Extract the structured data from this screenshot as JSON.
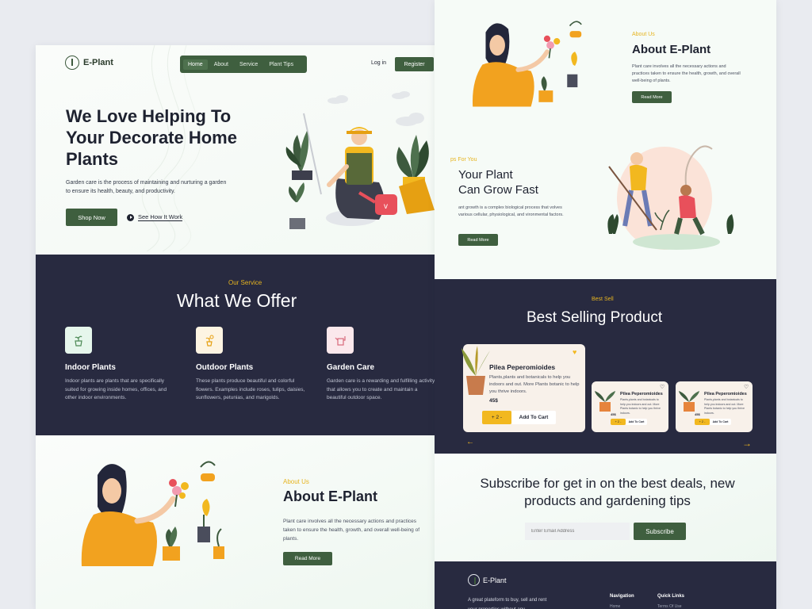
{
  "brand": {
    "name": "E-Plant"
  },
  "nav": {
    "items": [
      "Home",
      "About",
      "Service",
      "Plant Tips"
    ],
    "active": "Home",
    "login": "Log in",
    "register": "Register"
  },
  "hero": {
    "title": "We Love Helping To Your Decorate Home Plants",
    "description": "Garden care is the process of maintaining and nurturing a garden to ensure its health, beauty, and productivity.",
    "shop_button": "Shop Now",
    "video_link": "See How It Work"
  },
  "services": {
    "tag": "Our Service",
    "title": "What We Offer",
    "items": [
      {
        "name": "Indoor Plants",
        "description": "Indoor plants are plants that are specifically suited for growing inside homes, offices, and other indoor environments.",
        "icon": "potted-plant-icon",
        "icon_bg": "#e6f6ec"
      },
      {
        "name": "Outdoor Plants",
        "description": "These plants produce beautiful and colorful flowers. Examples include roses, tulips, daisies, sunflowers, petunias, and marigolds.",
        "icon": "sun-plant-icon",
        "icon_bg": "#fdf4e2"
      },
      {
        "name": "Garden Care",
        "description": "Garden care is a rewarding and fulfilling activity that allows you to create and maintain a beautiful outdoor space.",
        "icon": "watering-can-icon",
        "icon_bg": "#fbe8ec"
      }
    ]
  },
  "about": {
    "tag": "About Us",
    "title": "About E-Plant",
    "description": "Plant care involves all the necessary actions and practices taken to ensure the health, growth, and overall well-being of plants.",
    "button": "Read More"
  },
  "tips": {
    "tag": "ps For You",
    "title_line1": "Your Plant",
    "title_line2": "Can Grow Fast",
    "description": "ant growth is a complex biological process that volves various cellular, physiological, and vironmental factors.",
    "button": "Read More"
  },
  "best_sell": {
    "tag": "Best Sell",
    "title": "Best Selling Product",
    "products": [
      {
        "name": "Pilea Peperomioides",
        "description": "Plants,plants and botanicals to help you indoors and out. More Plants botanic to help you thrive indoors.",
        "price": "45$",
        "qty": "+ 2 -",
        "cart": "Add To Cart"
      },
      {
        "name": "Pilea Peperomioides",
        "description": "Plants,plants and botanicals to help you indoors and out. More Plants botanic to help you thrive indoors.",
        "price": "45$",
        "qty": "+ 2 -",
        "cart": "Add To Cart"
      },
      {
        "name": "Pilea Peperomioides",
        "description": "Plants,plants and botanicals to help you indoors and out. More Plants botanic to help you thrive indoors.",
        "price": "45$",
        "qty": "+ 2 -",
        "cart": "Add To Cart"
      }
    ]
  },
  "subscribe": {
    "title": "Subscribe for get in on the best deals, new products and gardening tips",
    "placeholder": "Enter Email Address",
    "button": "Subscribe"
  },
  "footer": {
    "brand": "E-Plant",
    "tagline": "A great plateform to buy, sell and rent your properties without any",
    "col1": "Navigation",
    "col1_item": "Home",
    "col2": "Quick Links",
    "col2_item": "Terms Of Use"
  },
  "colors": {
    "green": "#3f5f3f",
    "navy": "#282a40",
    "accent": "#e6b420"
  }
}
